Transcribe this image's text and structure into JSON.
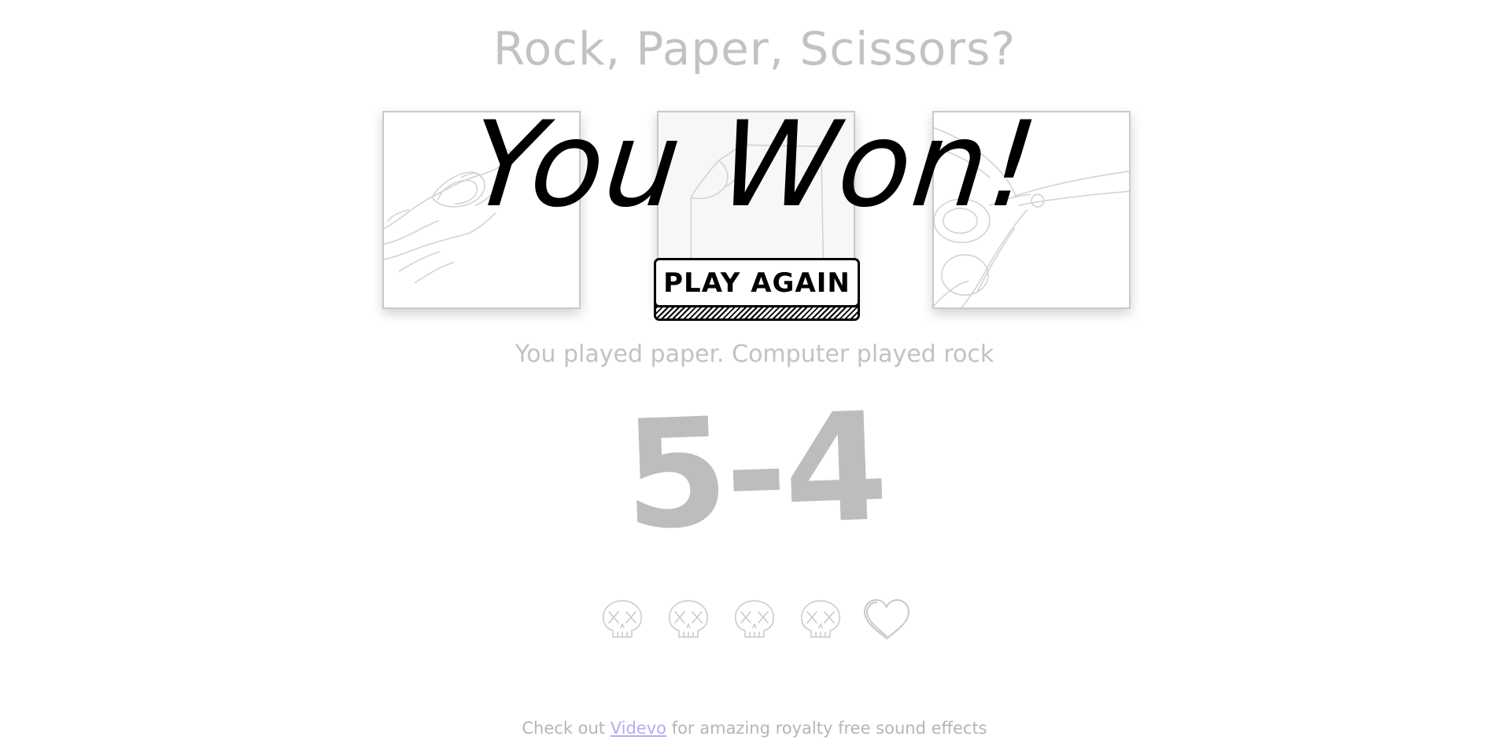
{
  "title": "Rock, Paper, Scissors?",
  "choices": [
    {
      "id": "rock",
      "icon": "rock-hand-icon"
    },
    {
      "id": "paper",
      "icon": "paper-sheet-icon"
    },
    {
      "id": "scissors",
      "icon": "scissors-icon"
    }
  ],
  "result": {
    "banner": "You Won!",
    "play_again_label": "PLAY AGAIN"
  },
  "played_text": "You played paper. Computer played rock",
  "score": "5-4",
  "lives": [
    {
      "icon": "skull-icon"
    },
    {
      "icon": "skull-icon"
    },
    {
      "icon": "skull-icon"
    },
    {
      "icon": "skull-icon"
    },
    {
      "icon": "heart-icon"
    }
  ],
  "footer": {
    "prefix": "Check out",
    "link_text": "Videvo",
    "suffix": "for amazing royalty free sound effects"
  },
  "colors": {
    "muted_text": "#c2c2c2",
    "score": "#bdbdbd",
    "link": "#b9a9f0",
    "banner": "#000000"
  }
}
